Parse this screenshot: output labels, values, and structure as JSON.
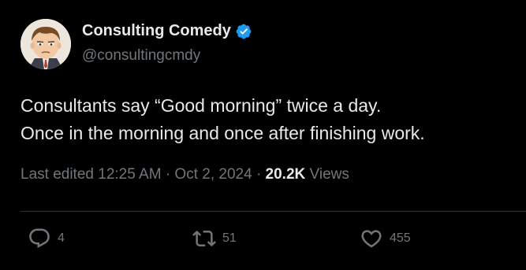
{
  "tweet": {
    "author": {
      "display_name": "Consulting Comedy",
      "handle": "@consultingcmdy",
      "verified": true,
      "verified_color": "#1d9bf0"
    },
    "text_lines": [
      "Consultants say “Good morning” twice a day.",
      "Once in the morning and once after finishing work."
    ],
    "meta": {
      "edited_label": "Last edited",
      "time": "12:25 AM",
      "separator": "·",
      "date": "Oct 2, 2024",
      "views_count": "20.2K",
      "views_label": "Views"
    },
    "actions": {
      "replies": {
        "icon": "reply-icon",
        "count": "4"
      },
      "reposts": {
        "icon": "repost-icon",
        "count": "51"
      },
      "likes": {
        "icon": "heart-icon",
        "count": "455"
      }
    }
  },
  "colors": {
    "background": "#000000",
    "primary_text": "#e7e9ea",
    "secondary_text": "#71767b",
    "divider": "#2f3336"
  }
}
